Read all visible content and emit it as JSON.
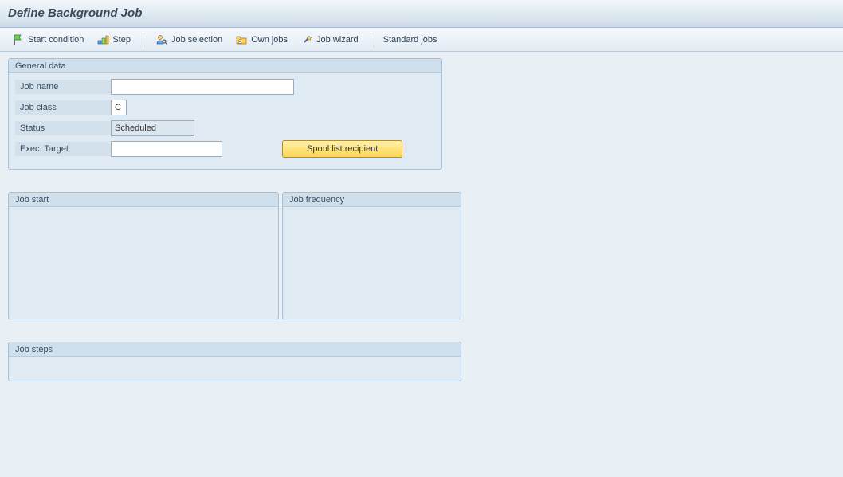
{
  "header": {
    "title": "Define Background Job"
  },
  "toolbar": {
    "start_condition": "Start condition",
    "step": "Step",
    "job_selection": "Job selection",
    "own_jobs": "Own jobs",
    "job_wizard": "Job wizard",
    "standard_jobs": "Standard jobs"
  },
  "panels": {
    "general": {
      "title": "General data",
      "fields": {
        "job_name": {
          "label": "Job name",
          "value": ""
        },
        "job_class": {
          "label": "Job class",
          "value": "C"
        },
        "status": {
          "label": "Status",
          "value": "Scheduled"
        },
        "exec_target": {
          "label": "Exec. Target",
          "value": ""
        }
      },
      "spool_button": "Spool list recipient"
    },
    "job_start": {
      "title": "Job start"
    },
    "job_frequency": {
      "title": "Job frequency"
    },
    "job_steps": {
      "title": "Job steps"
    }
  }
}
